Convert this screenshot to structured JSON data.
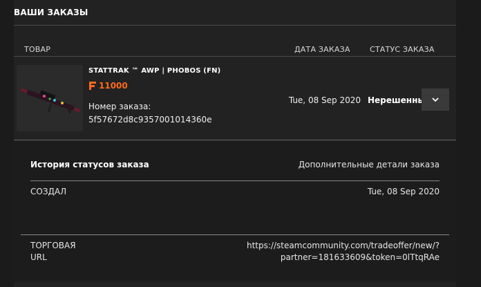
{
  "page": {
    "title": "ВАШИ ЗАКАЗЫ"
  },
  "table": {
    "col_product": "ТОВАР",
    "col_date": "ДАТА ЗАКАЗА",
    "col_status": "СТАТУС ЗАКАЗА"
  },
  "order": {
    "item_name": "STATTRAK ™ AWP | PHOBOS (FN)",
    "price": "11000",
    "order_label": "Номер заказа:",
    "order_number": "5f57672d8c9357001014360e",
    "date": "Tue, 08 Sep 2020",
    "status": "Нерешенный",
    "accent_color": "#ff6a1a"
  },
  "details": {
    "history_title": "История статусов заказа",
    "additional_title": "Дополнительные детали заказа",
    "created_label": "СОЗДАЛ",
    "created_date": "Tue, 08 Sep 2020",
    "trade_label_line1": "ТОРГОВАЯ",
    "trade_label_line2": "URL",
    "trade_url_line1": "https://steamcommunity.com/tradeoffer/new/?",
    "trade_url_line2": "partner=181633609&token=0lTtqRAe"
  },
  "icons": {
    "price": "currency-f-icon",
    "expand": "chevron-down-icon"
  }
}
